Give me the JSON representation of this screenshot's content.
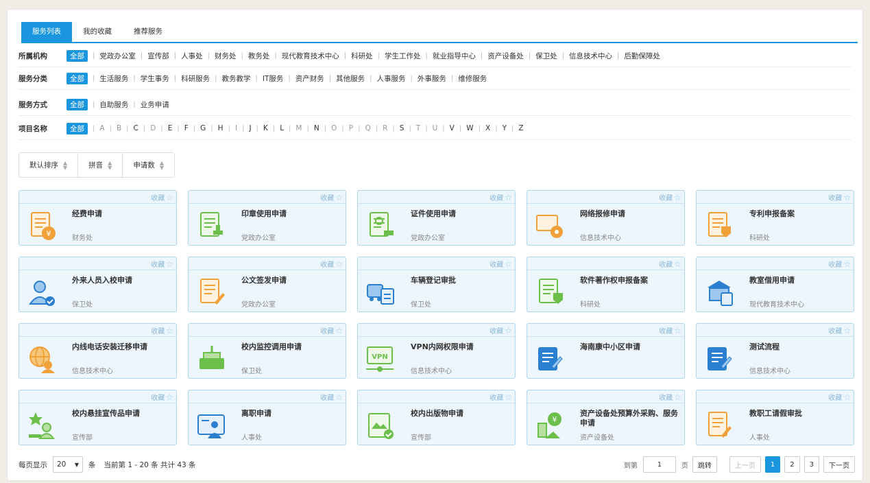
{
  "tabs": [
    "服务列表",
    "我的收藏",
    "推荐服务"
  ],
  "filters": {
    "org": {
      "label": "所属机构",
      "items": [
        "全部",
        "党政办公室",
        "宣传部",
        "人事处",
        "财务处",
        "教务处",
        "现代教育技术中心",
        "科研处",
        "学生工作处",
        "就业指导中心",
        "资产设备处",
        "保卫处",
        "信息技术中心",
        "后勤保障处"
      ]
    },
    "category": {
      "label": "服务分类",
      "items": [
        "全部",
        "生活服务",
        "学生事务",
        "科研服务",
        "教务教学",
        "IT服务",
        "资产财务",
        "其他服务",
        "人事服务",
        "外事服务",
        "维修服务"
      ]
    },
    "method": {
      "label": "服务方式",
      "items": [
        "全部",
        "自助服务",
        "业务申请"
      ]
    },
    "name": {
      "label": "项目名称",
      "items": [
        "全部",
        "A",
        "B",
        "C",
        "D",
        "E",
        "F",
        "G",
        "H",
        "I",
        "J",
        "K",
        "L",
        "M",
        "N",
        "O",
        "P",
        "Q",
        "R",
        "S",
        "T",
        "U",
        "V",
        "W",
        "X",
        "Y",
        "Z"
      ]
    }
  },
  "sort": [
    "默认排序",
    "拼音",
    "申请数"
  ],
  "fav_label": "收藏",
  "cards": [
    {
      "title": "经费申请",
      "dept": "财务处",
      "icon": "finance-coin-icon"
    },
    {
      "title": "印章使用申请",
      "dept": "党政办公室",
      "icon": "seal-document-icon"
    },
    {
      "title": "证件使用申请",
      "dept": "党政办公室",
      "icon": "certificate-icon"
    },
    {
      "title": "网络报修申请",
      "dept": "信息技术中心",
      "icon": "network-repair-icon"
    },
    {
      "title": "专利申报备案",
      "dept": "科研处",
      "icon": "patent-icon"
    },
    {
      "title": "外来人员入校申请",
      "dept": "保卫处",
      "icon": "visitor-icon"
    },
    {
      "title": "公文签发申请",
      "dept": "党政办公室",
      "icon": "document-sign-icon"
    },
    {
      "title": "车辆登记审批",
      "dept": "保卫处",
      "icon": "vehicle-icon"
    },
    {
      "title": "软件著作权申报备案",
      "dept": "科研处",
      "icon": "copyright-icon"
    },
    {
      "title": "教室借用申请",
      "dept": "现代教育技术中心",
      "icon": "classroom-icon"
    },
    {
      "title": "内线电话安装迁移申请",
      "dept": "信息技术中心",
      "icon": "phone-globe-icon"
    },
    {
      "title": "校内监控调用申请",
      "dept": "保卫处",
      "icon": "monitor-desk-icon"
    },
    {
      "title": "VPN内网权限申请",
      "dept": "信息技术中心",
      "icon": "vpn-icon"
    },
    {
      "title": "海南康中小区申请",
      "dept": "",
      "icon": "form-edit-icon"
    },
    {
      "title": "测试流程",
      "dept": "信息技术中心",
      "icon": "form-edit-icon"
    },
    {
      "title": "校内悬挂宣传品申请",
      "dept": "宣传部",
      "icon": "banner-person-icon"
    },
    {
      "title": "离职申请",
      "dept": "人事处",
      "icon": "resign-card-icon"
    },
    {
      "title": "校内出版物申请",
      "dept": "宣传部",
      "icon": "publication-icon"
    },
    {
      "title": "资产设备处预算外采购、服务申请",
      "dept": "资产设备处",
      "icon": "budget-icon"
    },
    {
      "title": "教职工请假审批",
      "dept": "人事处",
      "icon": "leave-form-icon"
    }
  ],
  "footer": {
    "per_page_label": "每页显示",
    "per_page_value": "20",
    "per_page_unit": "条",
    "summary": "当前第 1 - 20 条 共计 43 条",
    "goto_label": "到第",
    "goto_value": "1",
    "page_unit": "页",
    "jump_label": "跳转",
    "prev_label": "上一页",
    "pages": [
      "1",
      "2",
      "3"
    ],
    "next_label": "下一页"
  },
  "colors": {
    "accent": "#1996dd",
    "card_bg": "#edf6fc",
    "card_border": "#aed5ee"
  }
}
